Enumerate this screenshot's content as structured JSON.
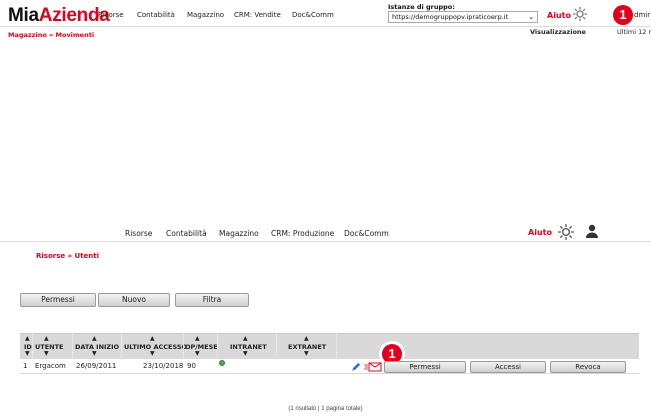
{
  "top": {
    "logo_prefix": "Mia",
    "logo_suffix": "Azienda",
    "nav": [
      "Risorse",
      "Contabilità",
      "Magazzino",
      "CRM: Vendite",
      "Doc&Comm"
    ],
    "group_label": "Istanze di gruppo:",
    "group_value": "https://demogruppopv.ipraticoerp.it",
    "help": "Aiuto",
    "badge": "1",
    "user_partial": "dmir",
    "breadcrumb": "Magazzino » Movimenti",
    "viz_label": "Visualizzazione",
    "viz_value": "Ultimi 12 m"
  },
  "window2": {
    "nav": [
      "Risorse",
      "Contabilità",
      "Magazzino",
      "CRM: Produzione",
      "Doc&Comm"
    ],
    "help": "Aiuto",
    "breadcrumb": "Risorse » Utenti",
    "buttons": {
      "permessi": "Permessi",
      "nuovo": "Nuovo",
      "filtra": "Filtra"
    },
    "table": {
      "headers": [
        "ID",
        "UTENTE",
        "DATA INIZIO",
        "ULTIMO ACCESSO",
        "OP/MESE",
        "INTRANET",
        "EXTRANET"
      ],
      "rows": [
        {
          "id": "1",
          "utente": "Ergacom",
          "data_inizio": "26/09/2011",
          "ultimo_accesso": "23/10/2018",
          "op_mese": "90",
          "intranet_status": "green"
        }
      ],
      "row_badge": "1",
      "row_buttons": {
        "permessi": "Permessi",
        "accessi": "Accessi",
        "revoca": "Revoca"
      }
    },
    "footer": "(1 risultato | 1 pagina totale)"
  },
  "colors": {
    "brand_red": "#e3001b",
    "status_green": "#4caf50"
  },
  "icons": [
    "gear-icon",
    "user-icon",
    "edit-pencil-icon",
    "mail-icon",
    "chevron-down-icon",
    "sort-up-icon",
    "sort-down-icon"
  ]
}
